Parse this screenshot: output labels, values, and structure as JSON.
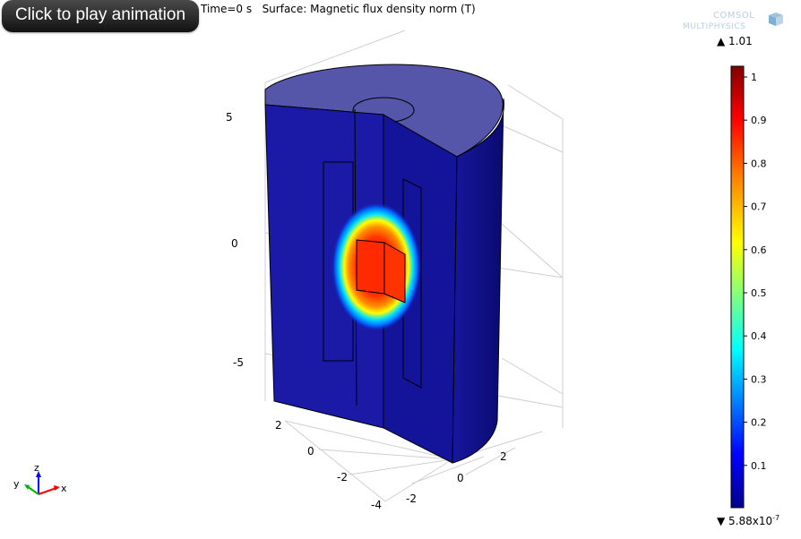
{
  "toolbar": {
    "play_label": "Click to play animation"
  },
  "plot": {
    "title": "Time=0 s   Surface: Magnetic flux density norm (T)",
    "logo_line1": "COMSOL",
    "logo_line2": "MULTIPHYSICS"
  },
  "axes": {
    "z_ticks": [
      "5",
      "0",
      "-5"
    ],
    "y_ticks": [
      "2",
      "0",
      "-2",
      "-4"
    ],
    "x_ticks": [
      "-2",
      "0",
      "2"
    ],
    "triad": {
      "z": "z",
      "y": "y",
      "x": "x"
    }
  },
  "colorbar": {
    "max_label": "1.01",
    "min_label": "5.88x10",
    "min_exp": "-7",
    "ticks": [
      "1",
      "0.9",
      "0.8",
      "0.7",
      "0.6",
      "0.5",
      "0.4",
      "0.3",
      "0.2",
      "0.1"
    ],
    "colors": [
      "#7a0000",
      "#ff0000",
      "#ff8000",
      "#ffff00",
      "#00ffff",
      "#0060ff",
      "#00009c"
    ]
  }
}
